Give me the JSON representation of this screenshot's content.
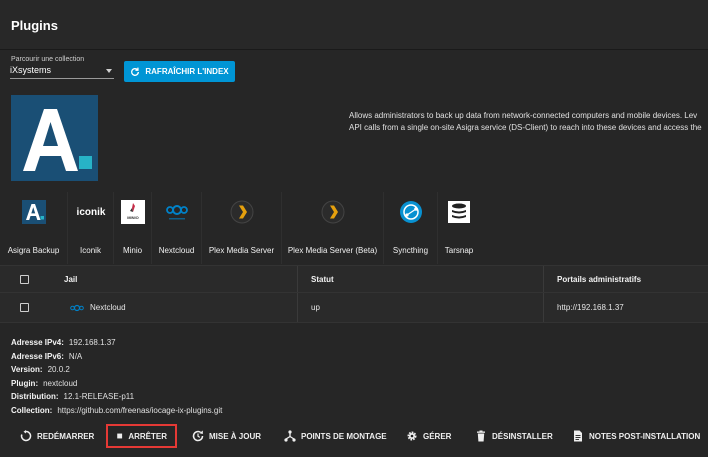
{
  "header": {
    "title": "Plugins"
  },
  "collection": {
    "label": "Parcourir une collection",
    "value": "iXsystems"
  },
  "refresh_button": {
    "label": "RAFRAÎCHIR L'INDEX"
  },
  "description": {
    "line1": "Allows administrators to back up data from network-connected computers and mobile devices. Lev",
    "line2": "API calls from a single on-site Asigra service (DS-Client) to reach into these devices and access the"
  },
  "plugins": [
    {
      "name": "Asigra Backup",
      "icon": "asigra-icon"
    },
    {
      "name": "Iconik",
      "icon": "iconik-icon"
    },
    {
      "name": "Minio",
      "icon": "minio-icon"
    },
    {
      "name": "Nextcloud",
      "icon": "nextcloud-icon"
    },
    {
      "name": "Plex Media Server",
      "icon": "plex-icon"
    },
    {
      "name": "Plex Media Server (Beta)",
      "icon": "plex-beta-icon"
    },
    {
      "name": "Syncthing",
      "icon": "syncthing-icon"
    },
    {
      "name": "Tarsnap",
      "icon": "tarsnap-icon"
    }
  ],
  "plugin_logo_text": {
    "asigra": "A.",
    "iconik": "iconik",
    "minio": "MINIO"
  },
  "table": {
    "headers": {
      "jail": "Jail",
      "status": "Statut",
      "admin": "Portails administratifs"
    },
    "row": {
      "jail": "Nextcloud",
      "status": "up",
      "admin": "http://192.168.1.37"
    }
  },
  "details": {
    "ipv4_label": "Adresse IPv4:",
    "ipv4": "192.168.1.37",
    "ipv6_label": "Adresse IPv6:",
    "ipv6": "N/A",
    "version_label": "Version:",
    "version": "20.0.2",
    "plugin_label": "Plugin:",
    "plugin": "nextcloud",
    "distribution_label": "Distribution:",
    "distribution": "12.1-RELEASE-p11",
    "collection_label": "Collection:",
    "collection": "https://github.com/freenas/iocage-ix-plugins.git"
  },
  "actions": {
    "restart": "REDÉMARRER",
    "stop": "ARRÊTER",
    "update": "MISE À JOUR",
    "mounts": "POINTS DE MONTAGE",
    "manage": "GÉRER",
    "uninstall": "DÉSINSTALLER",
    "notes": "NOTES POST-INSTALLATION"
  },
  "colors": {
    "accent": "#0095d5",
    "highlight": "#e53935",
    "asigra_bg": "#1a4f75",
    "asigra_square": "#27b3c7",
    "plex": "#e5a00d"
  }
}
